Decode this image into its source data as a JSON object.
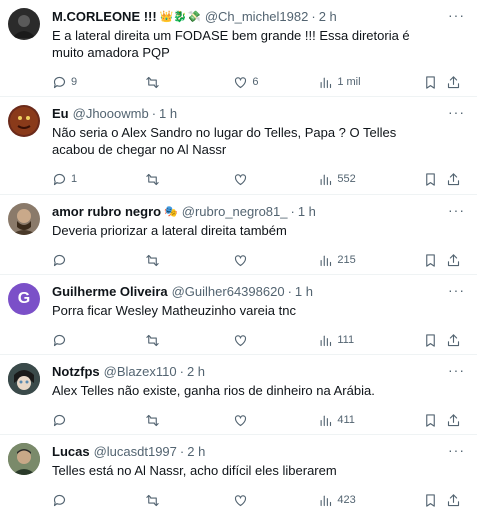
{
  "tweets": [
    {
      "name": "M.CORLEONE !!!",
      "emoji": "👑🐉💸",
      "handle": "@Ch_michel1982",
      "time": "2 h",
      "text": "E a lateral direita um FODASE bem grande !!! Essa diretoria é muito amadora PQP",
      "replies": "9",
      "retweets": "",
      "likes": "6",
      "views": "1 mil",
      "avatar_color": "#2b2b2b"
    },
    {
      "name": "Eu",
      "emoji": "",
      "handle": "@Jhooowmb",
      "time": "1 h",
      "text": "Não seria o Alex Sandro no lugar do Telles, Papa ? O Telles acabou de chegar no Al Nassr",
      "replies": "1",
      "retweets": "",
      "likes": "",
      "views": "552",
      "avatar_color": "#6b2a1a"
    },
    {
      "name": "amor rubro negro",
      "emoji": "🎭",
      "handle": "@rubro_negro81_",
      "time": "1 h",
      "text": "Deveria priorizar a lateral direita também",
      "replies": "",
      "retweets": "",
      "likes": "",
      "views": "215",
      "avatar_color": "#8a7a6a"
    },
    {
      "name": "Guilherme Oliveira",
      "emoji": "",
      "handle": "@Guilher64398620",
      "time": "1 h",
      "text": "Porra ficar Wesley Matheuzinho vareia tnc",
      "replies": "",
      "retweets": "",
      "likes": "",
      "views": "111",
      "avatar_color": "#7b50c8",
      "avatar_letter": "G"
    },
    {
      "name": "Notzfps",
      "emoji": "",
      "handle": "@Blazex110",
      "time": "2 h",
      "text": "Alex Telles não existe, ganha rios de dinheiro na Arábia.",
      "replies": "",
      "retweets": "",
      "likes": "",
      "views": "411",
      "avatar_color": "#2f3a3a"
    },
    {
      "name": "Lucas",
      "emoji": "",
      "handle": "@lucasdt1997",
      "time": "2 h",
      "text": "Telles está no Al Nassr, acho difícil eles liberarem",
      "replies": "",
      "retweets": "",
      "likes": "",
      "views": "423",
      "avatar_color": "#5a6b4a"
    }
  ],
  "ui": {
    "dot": "·",
    "more": "···"
  }
}
